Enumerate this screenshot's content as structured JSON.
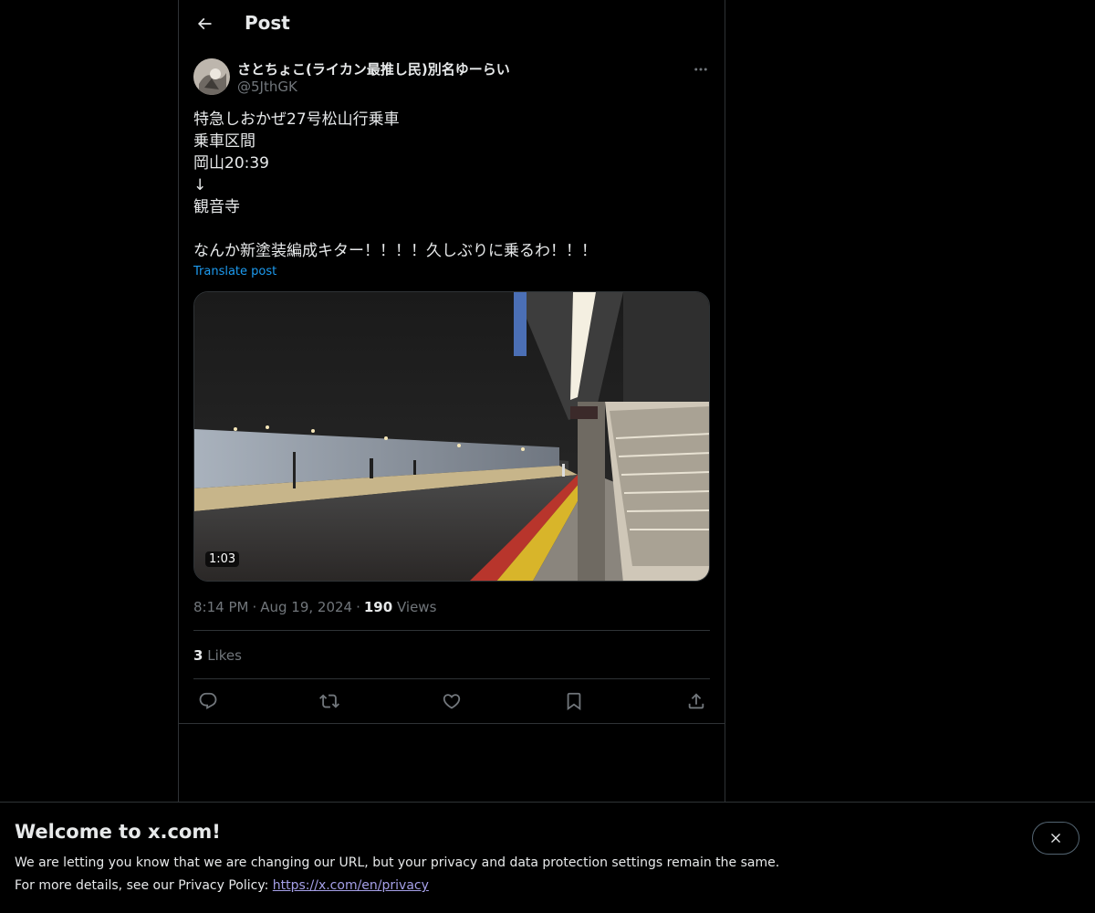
{
  "header": {
    "title": "Post",
    "back_icon": "arrow-left-icon"
  },
  "post": {
    "display_name": "さとちょこ(ライカン最推し民)別名ゆーらい",
    "handle": "@5JthGK",
    "body": "特急しおかぜ27号松山行乗車\n乗車区間\n岡山20:39\n↓\n観音寺\n\nなんか新塗装編成キター！！！！久しぶりに乗るわ！！！",
    "translate_label": "Translate post",
    "video_duration": "1:03",
    "time": "8:14 PM",
    "date": "Aug 19, 2024",
    "views_count": "190",
    "views_label": "Views",
    "likes_count": "3",
    "likes_label": "Likes"
  },
  "actions": [
    "reply-icon",
    "repost-icon",
    "like-icon",
    "bookmark-icon",
    "share-icon"
  ],
  "banner": {
    "title": "Welcome to x.com!",
    "line1": "We are letting you know that we are changing our URL, but your privacy and data protection settings remain the same.",
    "line2_prefix": "For more details, see our Privacy Policy: ",
    "link": "https://x.com/en/privacy"
  },
  "colors": {
    "background": "#000000",
    "text": "#e7e9ea",
    "muted": "#71767b",
    "accent": "#1d9bf0",
    "border": "#2f3336"
  }
}
